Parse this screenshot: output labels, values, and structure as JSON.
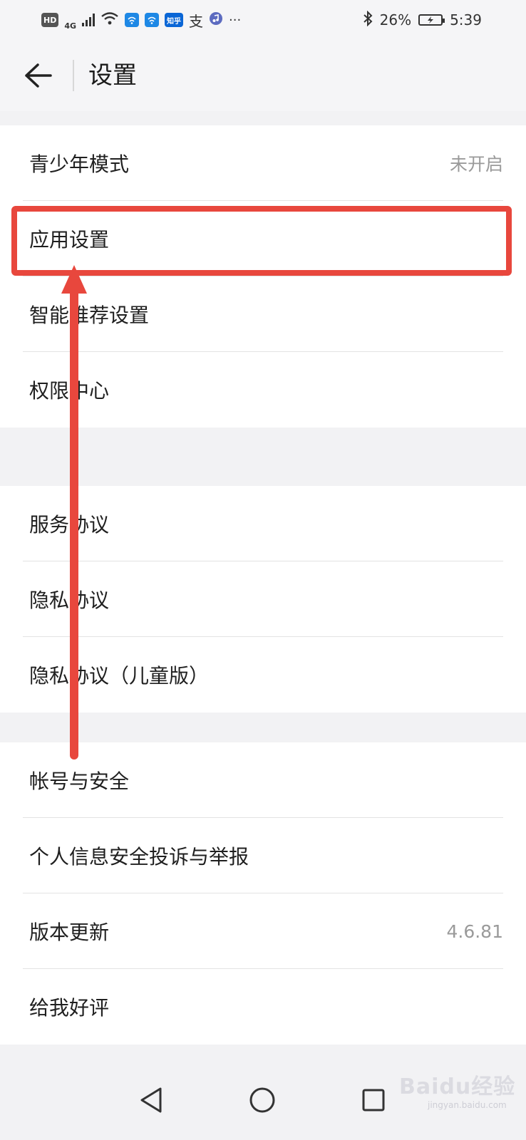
{
  "status_bar": {
    "hd": "HD",
    "network": "4G",
    "app_icons": [
      "wifi-app-icon",
      "wifi-app-icon",
      "zhihu-app-icon",
      "alipay-icon",
      "music-icon"
    ],
    "zhihu_label": "知乎",
    "alipay_label": "支",
    "more": "···",
    "battery_percent": "26%",
    "time": "5:39"
  },
  "header": {
    "title": "设置"
  },
  "sections": [
    {
      "items": [
        {
          "label": "青少年模式",
          "value": "未开启"
        },
        {
          "label": "应用设置",
          "value": ""
        },
        {
          "label": "智能推荐设置",
          "value": ""
        },
        {
          "label": "权限中心",
          "value": ""
        }
      ]
    },
    {
      "items": [
        {
          "label": "服务协议",
          "value": ""
        },
        {
          "label": "隐私协议",
          "value": ""
        },
        {
          "label": "隐私协议（儿童版）",
          "value": ""
        }
      ]
    },
    {
      "items": [
        {
          "label": "帐号与安全",
          "value": ""
        },
        {
          "label": "个人信息安全投诉与举报",
          "value": ""
        },
        {
          "label": "版本更新",
          "value": "4.6.81"
        },
        {
          "label": "给我好评",
          "value": ""
        }
      ]
    }
  ],
  "watermark": {
    "brand": "Baidu经验",
    "site": "jingyan.baidu.com"
  },
  "annotation": {
    "color": "#e8473d"
  }
}
